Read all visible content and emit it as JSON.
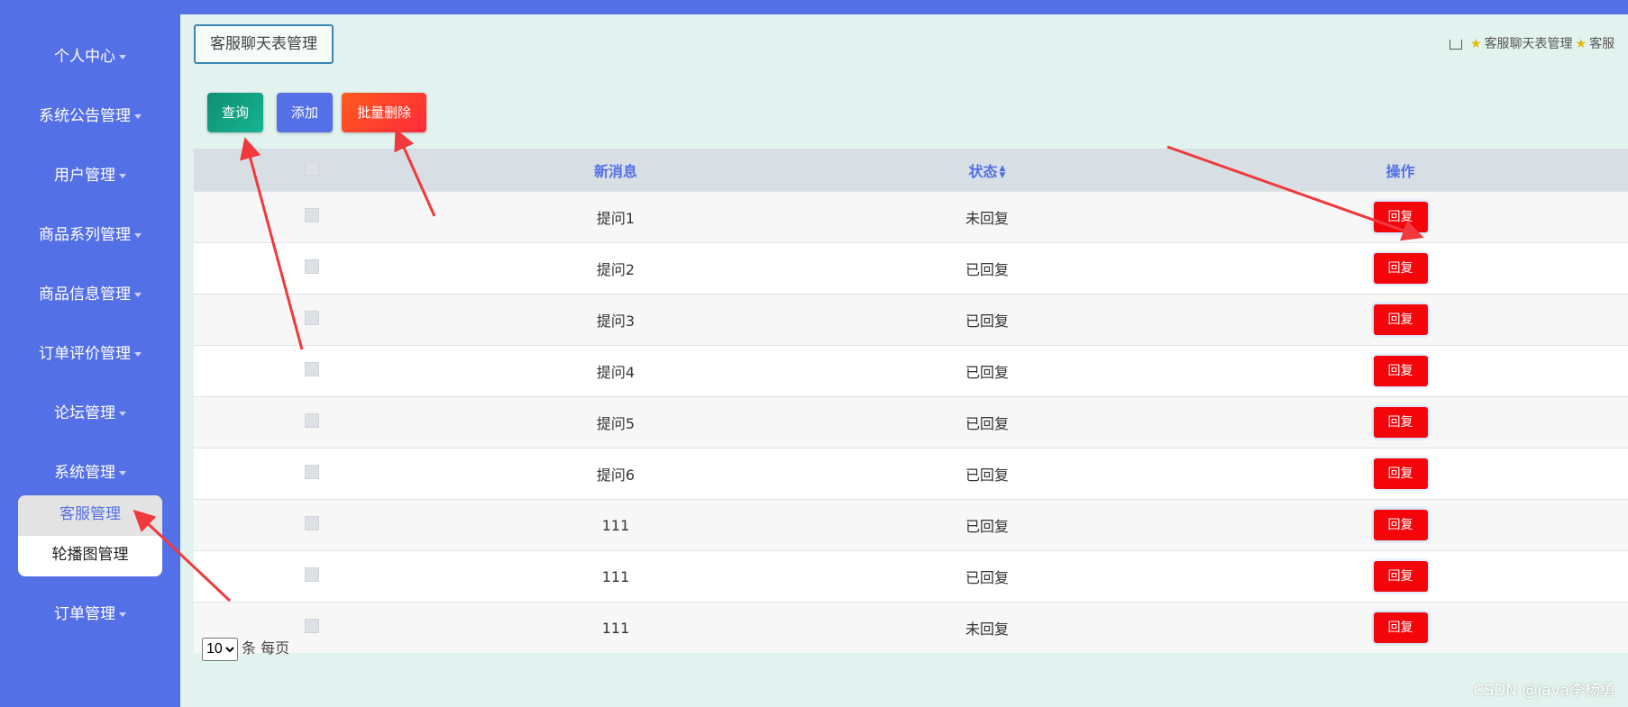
{
  "sidebar": {
    "menu": [
      {
        "label": "个人中心"
      },
      {
        "label": "系统公告管理"
      },
      {
        "label": "用户管理"
      },
      {
        "label": "商品系列管理"
      },
      {
        "label": "商品信息管理"
      },
      {
        "label": "订单评价管理"
      },
      {
        "label": "论坛管理"
      },
      {
        "label": "系统管理"
      },
      {
        "label": "订单管理"
      }
    ],
    "submenu": [
      {
        "label": "客服管理",
        "active": true
      },
      {
        "label": "轮播图管理",
        "active": false
      }
    ]
  },
  "header": {
    "title": "客服聊天表管理",
    "breadcrumb": [
      "客服聊天表管理",
      "客服"
    ]
  },
  "toolbar": {
    "query_label": "查询",
    "add_label": "添加",
    "batch_delete_label": "批量删除"
  },
  "table": {
    "columns": [
      "新消息",
      "状态",
      "操作"
    ],
    "rows": [
      {
        "message": "提问1",
        "status": "未回复",
        "action": "回复"
      },
      {
        "message": "提问2",
        "status": "已回复",
        "action": "回复"
      },
      {
        "message": "提问3",
        "status": "已回复",
        "action": "回复"
      },
      {
        "message": "提问4",
        "status": "已回复",
        "action": "回复"
      },
      {
        "message": "提问5",
        "status": "已回复",
        "action": "回复"
      },
      {
        "message": "提问6",
        "status": "已回复",
        "action": "回复"
      },
      {
        "message": "111",
        "status": "已回复",
        "action": "回复"
      },
      {
        "message": "111",
        "status": "已回复",
        "action": "回复"
      },
      {
        "message": "111",
        "status": "未回复",
        "action": "回复"
      }
    ]
  },
  "pagination": {
    "page_size": "10",
    "per_page_label": "条 每页"
  },
  "watermark": "CSDN @java李杨勇",
  "colors": {
    "sidebar": "#5470e6",
    "background": "#e2f3ef",
    "reply_button": "#f3050a",
    "annotation_arrow": "#f0393d"
  },
  "icons": [
    "home-icon",
    "star-icon",
    "caret-down-icon",
    "sort-icon"
  ]
}
